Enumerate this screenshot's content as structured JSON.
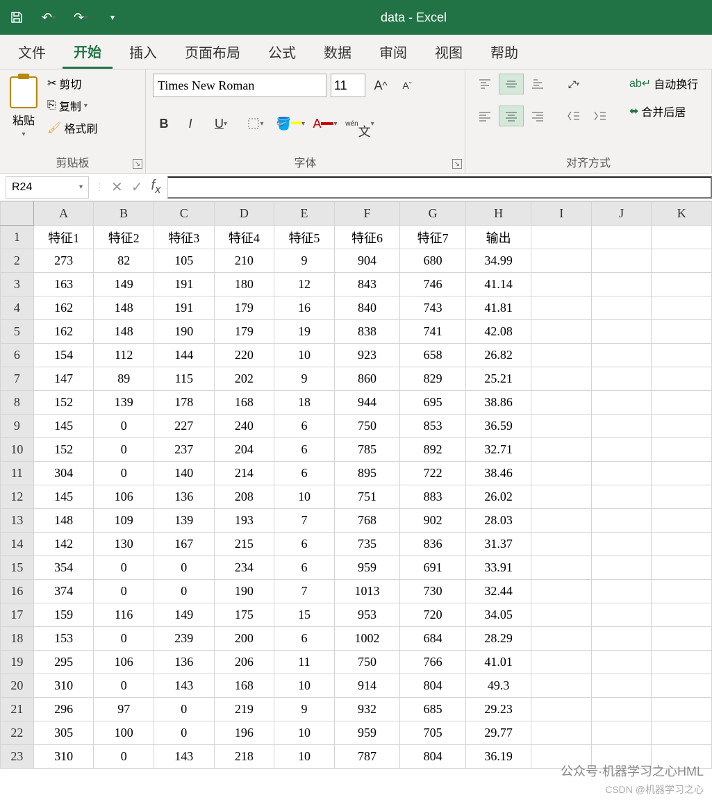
{
  "title": "data  -  Excel",
  "qat": {
    "save": "💾",
    "undo": "↶",
    "redo": "↷",
    "custom": "▾"
  },
  "tabs": [
    "文件",
    "开始",
    "插入",
    "页面布局",
    "公式",
    "数据",
    "审阅",
    "视图",
    "帮助"
  ],
  "ribbon": {
    "clipboard": {
      "label": "剪贴板",
      "paste": "粘贴",
      "cut": "剪切",
      "copy": "复制",
      "format_painter": "格式刷"
    },
    "font": {
      "label": "字体",
      "name": "Times New Roman",
      "size": "11",
      "bold": "B",
      "italic": "I",
      "underline": "U",
      "phonetic": "wén"
    },
    "align": {
      "label": "对齐方式",
      "wrap": "自动换行",
      "merge": "合并后居"
    }
  },
  "namebox": "R24",
  "formula": "",
  "columns": [
    "A",
    "B",
    "C",
    "D",
    "E",
    "F",
    "G",
    "H",
    "I",
    "J",
    "K"
  ],
  "header_row": [
    "特征1",
    "特征2",
    "特征3",
    "特征4",
    "特征5",
    "特征6",
    "特征7",
    "输出",
    "",
    "",
    ""
  ],
  "rows": [
    [
      273,
      82,
      105,
      210,
      9,
      904,
      680,
      34.99,
      "",
      "",
      ""
    ],
    [
      163,
      149,
      191,
      180,
      12,
      843,
      746,
      41.14,
      "",
      "",
      ""
    ],
    [
      162,
      148,
      191,
      179,
      16,
      840,
      743,
      41.81,
      "",
      "",
      ""
    ],
    [
      162,
      148,
      190,
      179,
      19,
      838,
      741,
      42.08,
      "",
      "",
      ""
    ],
    [
      154,
      112,
      144,
      220,
      10,
      923,
      658,
      26.82,
      "",
      "",
      ""
    ],
    [
      147,
      89,
      115,
      202,
      9,
      860,
      829,
      25.21,
      "",
      "",
      ""
    ],
    [
      152,
      139,
      178,
      168,
      18,
      944,
      695,
      38.86,
      "",
      "",
      ""
    ],
    [
      145,
      0,
      227,
      240,
      6,
      750,
      853,
      36.59,
      "",
      "",
      ""
    ],
    [
      152,
      0,
      237,
      204,
      6,
      785,
      892,
      32.71,
      "",
      "",
      ""
    ],
    [
      304,
      0,
      140,
      214,
      6,
      895,
      722,
      38.46,
      "",
      "",
      ""
    ],
    [
      145,
      106,
      136,
      208,
      10,
      751,
      883,
      26.02,
      "",
      "",
      ""
    ],
    [
      148,
      109,
      139,
      193,
      7,
      768,
      902,
      28.03,
      "",
      "",
      ""
    ],
    [
      142,
      130,
      167,
      215,
      6,
      735,
      836,
      31.37,
      "",
      "",
      ""
    ],
    [
      354,
      0,
      0,
      234,
      6,
      959,
      691,
      33.91,
      "",
      "",
      ""
    ],
    [
      374,
      0,
      0,
      190,
      7,
      1013,
      730,
      32.44,
      "",
      "",
      ""
    ],
    [
      159,
      116,
      149,
      175,
      15,
      953,
      720,
      34.05,
      "",
      "",
      ""
    ],
    [
      153,
      0,
      239,
      200,
      6,
      1002,
      684,
      28.29,
      "",
      "",
      ""
    ],
    [
      295,
      106,
      136,
      206,
      11,
      750,
      766,
      41.01,
      "",
      "",
      ""
    ],
    [
      310,
      0,
      143,
      168,
      10,
      914,
      804,
      49.3,
      "",
      "",
      ""
    ],
    [
      296,
      97,
      0,
      219,
      9,
      932,
      685,
      29.23,
      "",
      "",
      ""
    ],
    [
      305,
      100,
      0,
      196,
      10,
      959,
      705,
      29.77,
      "",
      "",
      ""
    ],
    [
      310,
      0,
      143,
      218,
      10,
      787,
      804,
      36.19,
      "",
      "",
      ""
    ]
  ],
  "watermark": {
    "mid": "公众号·机器学习之心HML",
    "bottom": "CSDN @机器学习之心"
  }
}
